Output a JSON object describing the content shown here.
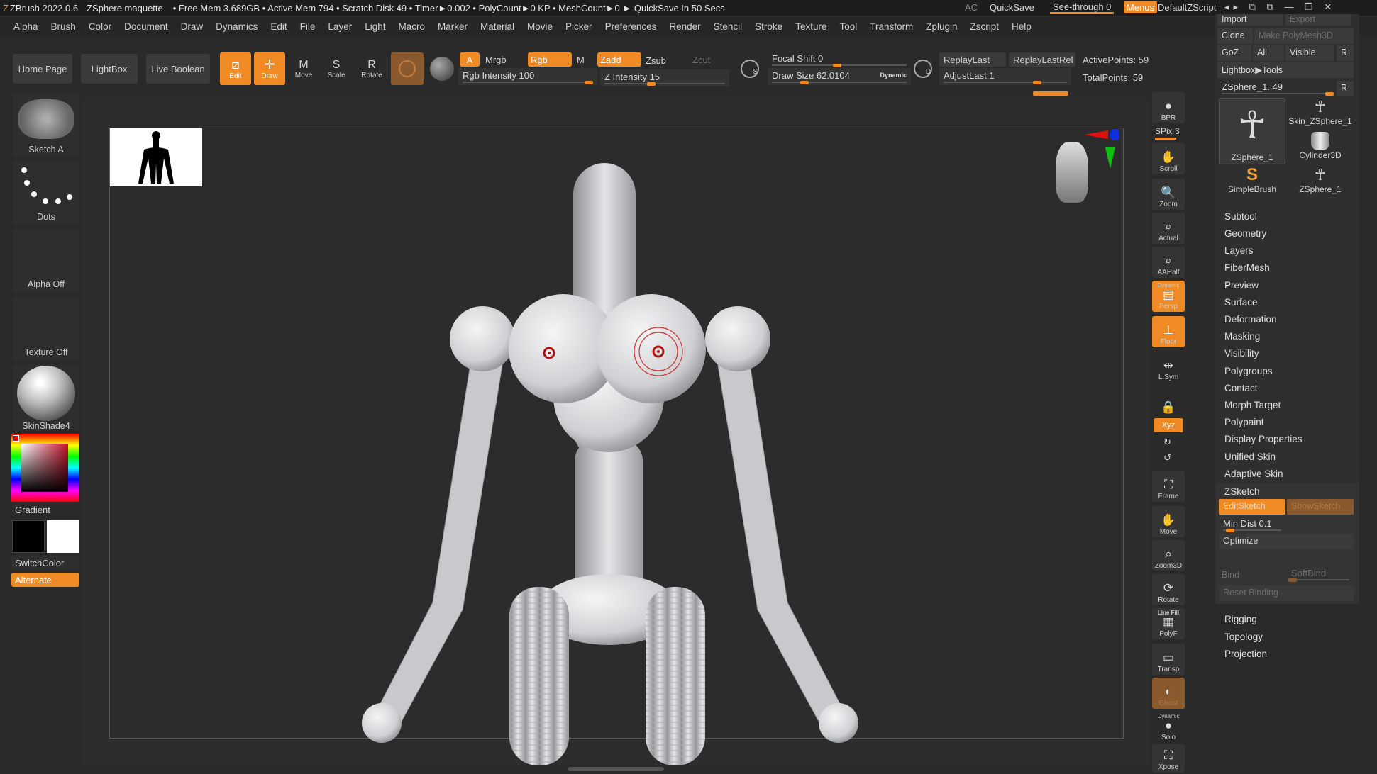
{
  "titlebar": {
    "app": "ZBrush 2022.0.6",
    "doc": "ZSphere maquette",
    "stats": "• Free Mem 3.689GB • Active Mem 794 • Scratch Disk 49 •  Timer►0.002 • PolyCount►0 KP  • MeshCount►0  ► QuickSave In 50 Secs",
    "ac": "AC",
    "quicksave": "QuickSave",
    "seethrough": "See-through  0",
    "menus": "Menus",
    "script": "DefaultZScript"
  },
  "menubar": [
    "Alpha",
    "Brush",
    "Color",
    "Document",
    "Draw",
    "Dynamics",
    "Edit",
    "File",
    "Layer",
    "Light",
    "Macro",
    "Marker",
    "Material",
    "Movie",
    "Picker",
    "Preferences",
    "Render",
    "Stencil",
    "Stroke",
    "Texture",
    "Tool",
    "Transform",
    "Zplugin",
    "Zscript",
    "Help"
  ],
  "toolbar": {
    "home": "Home Page",
    "lightbox": "LightBox",
    "liveboolean": "Live Boolean",
    "edit": "Edit",
    "draw": "Draw",
    "move": "Move",
    "scale": "Scale",
    "rotate": "Rotate",
    "a": "A",
    "mrgb": "Mrgb",
    "rgb": "Rgb",
    "m": "M",
    "zadd": "Zadd",
    "zsub": "Zsub",
    "zcut": "Zcut",
    "rgb_intensity": "Rgb Intensity 100",
    "z_intensity": "Z Intensity 15",
    "focal_shift": "Focal Shift 0",
    "draw_size": "Draw Size 62.0104",
    "dynamic": "Dynamic",
    "replaylast": "ReplayLast",
    "replaylastrel": "ReplayLastRel",
    "adjustlast": "AdjustLast 1",
    "activepoints": "ActivePoints: 59",
    "totalpoints": "TotalPoints: 59",
    "s_label": "S",
    "d_label": "D"
  },
  "leftshelf": {
    "brush": "Sketch A",
    "stroke": "Dots",
    "alpha": "Alpha Off",
    "texture": "Texture Off",
    "material": "SkinShade4",
    "gradient": "Gradient",
    "switchcolor": "SwitchColor",
    "alternate": "Alternate"
  },
  "righttools": [
    {
      "label": "BPR",
      "icon": "bpr-icon"
    },
    {
      "label": "SPix 3",
      "icon": ""
    },
    {
      "label": "Scroll",
      "icon": "scroll-icon"
    },
    {
      "label": "Zoom",
      "icon": "zoom-icon"
    },
    {
      "label": "Actual",
      "icon": "actual-icon"
    },
    {
      "label": "AAHalf",
      "icon": "aahalf-icon"
    },
    {
      "label": "Persp",
      "icon": "persp-icon",
      "top": "Dynamic"
    },
    {
      "label": "Floor",
      "icon": "floor-icon"
    },
    {
      "label": "L.Sym",
      "icon": "lsym-icon"
    },
    {
      "label": "",
      "icon": "lock-icon"
    },
    {
      "label": "Xyz",
      "icon": "xyz-icon"
    },
    {
      "label": "Frame",
      "icon": "frame-icon"
    },
    {
      "label": "Move",
      "icon": "move-icon"
    },
    {
      "label": "Zoom3D",
      "icon": "zoom3d-icon"
    },
    {
      "label": "Rotate",
      "icon": "rotate-icon"
    },
    {
      "label": "PolyF",
      "icon": "polyf-icon",
      "top": "Line Fill"
    },
    {
      "label": "Transp",
      "icon": "transp-icon"
    },
    {
      "label": "Ghost",
      "icon": "ghost-icon"
    },
    {
      "label": "Solo",
      "icon": "solo-icon",
      "top": "Dynamic"
    },
    {
      "label": "Xpose",
      "icon": "xpose-icon"
    }
  ],
  "toolpanel": {
    "import": "Import",
    "export": "Export",
    "clone": "Clone",
    "make_polymesh": "Make PolyMesh3D",
    "goz": "GoZ",
    "all": "All",
    "visible": "Visible",
    "r": "R",
    "lightbox_tools": "Lightbox▶Tools",
    "current_tool": "ZSphere_1. 49",
    "tools": [
      "ZSphere_1",
      "Skin_ZSphere_1",
      "Cylinder3D",
      "SimpleBrush",
      "ZSphere_1"
    ],
    "menu_items": [
      "Subtool",
      "Geometry",
      "Layers",
      "FiberMesh",
      "Preview",
      "Surface",
      "Deformation",
      "Masking",
      "Visibility",
      "Polygroups",
      "Contact",
      "Morph Target",
      "Polypaint",
      "Display Properties",
      "Unified Skin",
      "Adaptive Skin",
      "ZSketch"
    ],
    "editsketch": "EditSketch",
    "showsketch": "ShowSketch",
    "mindist": "Min Dist 0.1",
    "optimize": "Optimize",
    "bind": "Bind",
    "softbind": "SoftBind",
    "resetbinding": "Reset Binding",
    "bottom_items": [
      "Rigging",
      "Topology",
      "Projection"
    ]
  }
}
